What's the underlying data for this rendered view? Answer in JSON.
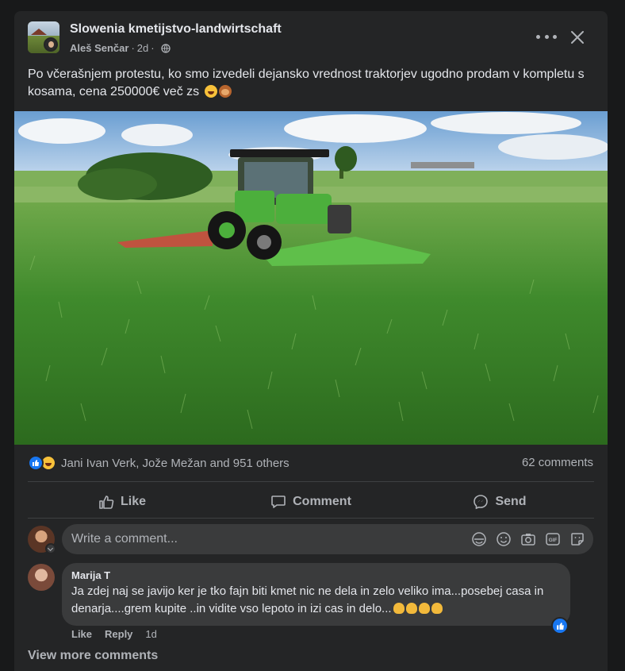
{
  "post": {
    "group_name": "Slowenia kmetijstvo-landwirtschaft",
    "author": "Aleš Senčar",
    "time": "2d",
    "text": "Po včerašnjem protestu, ko smo izvedeli dejansko vrednost traktorjev ugodno prodam v kompletu s kosama, cena 250000€ več zs",
    "emojis": [
      "laughing-emoji",
      "monkey-emoji"
    ],
    "image": "green tractor with mowers in a tall grass field"
  },
  "stats": {
    "reactions_text": "Jani Ivan Verk, Jože Mežan and 951 others",
    "reaction_types": [
      "like",
      "haha"
    ],
    "comments_count": "62 comments"
  },
  "actions": {
    "like": "Like",
    "comment": "Comment",
    "send": "Send"
  },
  "composer": {
    "placeholder": "Write a comment..."
  },
  "comment": {
    "author": "Marija T",
    "text": "Ja zdej naj se javijo ker je tko fajn biti kmet nic ne dela in zelo veliko ima...posebej casa in denarja....grem kupite ..in vidite vso lepoto in izi cas in delo...",
    "like_label": "Like",
    "reply_label": "Reply",
    "time": "1d",
    "reaction": "like"
  },
  "footer": {
    "view_more": "View more comments"
  },
  "colors": {
    "background": "#18191a",
    "card": "#242526",
    "bubble": "#3a3b3c",
    "text_primary": "#e4e6eb",
    "text_secondary": "#b0b3b8",
    "accent": "#1877f2"
  }
}
